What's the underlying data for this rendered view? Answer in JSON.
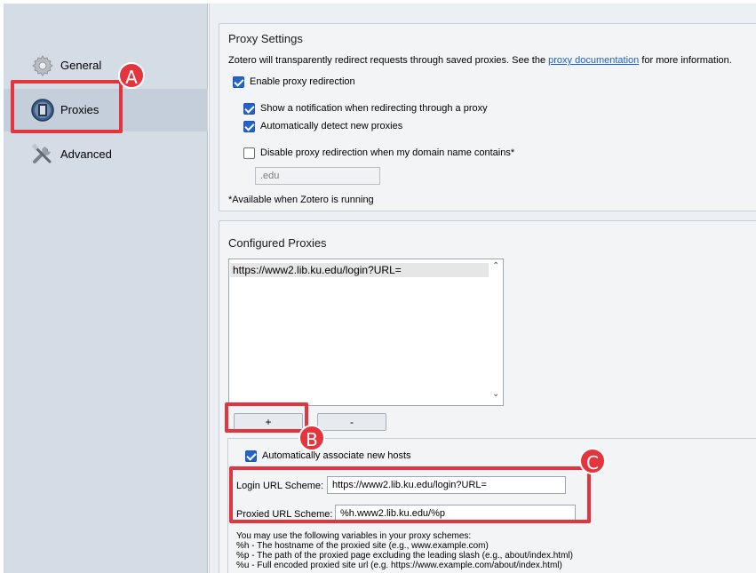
{
  "sidebar": {
    "items": [
      {
        "label": "General",
        "icon": "gear-icon"
      },
      {
        "label": "Proxies",
        "icon": "proxy-door-icon"
      },
      {
        "label": "Advanced",
        "icon": "tools-icon"
      }
    ]
  },
  "proxy_settings": {
    "title": "Proxy Settings",
    "desc_prefix": "Zotero will transparently redirect requests through saved proxies. See the ",
    "desc_link": "proxy documentation",
    "desc_suffix": " for more information.",
    "enable_redirection": "Enable proxy redirection",
    "show_notification": "Show a notification when redirecting through a proxy",
    "auto_detect": "Automatically detect new proxies",
    "disable_domain": "Disable proxy redirection when my domain name contains*",
    "domain_value": ".edu",
    "footnote": "*Available when Zotero is running"
  },
  "configured_proxies": {
    "title": "Configured Proxies",
    "entries": [
      "https://www2.lib.ku.edu/login?URL="
    ],
    "add_label": "+",
    "remove_label": "-"
  },
  "host_settings": {
    "auto_associate": "Automatically associate new hosts",
    "login_label": "Login URL Scheme:",
    "login_value": "https://www2.lib.ku.edu/login?URL=",
    "proxied_label": "Proxied URL Scheme:",
    "proxied_value": "%h.www2.lib.ku.edu/%p",
    "help_intro": "You may use the following variables in your proxy schemes:",
    "help_h": "%h - The hostname of the proxied site (e.g., www.example.com)",
    "help_p": "%p - The path of the proxied page excluding the leading slash (e.g., about/index.html)",
    "help_u": "%u - Full encoded proxied site url (e.g. https://www.example.com/about/index.html)"
  },
  "annotations": {
    "a": "A",
    "b": "B",
    "c": "C",
    "color": "#e4353f"
  }
}
